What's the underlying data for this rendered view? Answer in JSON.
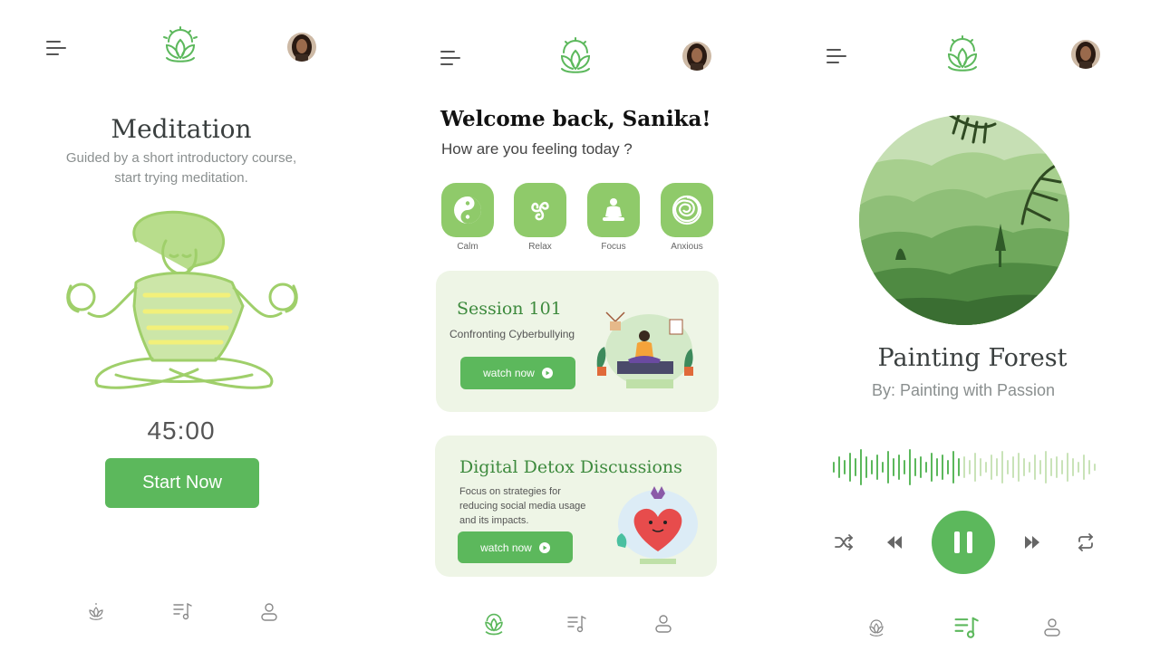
{
  "screen1": {
    "title": "Meditation",
    "subtitle_line1": "Guided by a short introductory course,",
    "subtitle_line2": "start trying meditation.",
    "timer": "45:00",
    "start_label": "Start Now"
  },
  "screen2": {
    "welcome": "Welcome back, Sanika!",
    "question": "How are you feeling today ?",
    "moods": [
      "Calm",
      "Relax",
      "Focus",
      "Anxious"
    ],
    "session_card": {
      "title": "Session 101",
      "subtitle": "Confronting Cyberbullying",
      "button": "watch now"
    },
    "detox_card": {
      "title": "Digital Detox Discussions",
      "desc_line1": "Focus on strategies for",
      "desc_line2": "reducing social media usage",
      "desc_line3": "and its impacts.",
      "button": "watch now"
    }
  },
  "screen3": {
    "track_title": "Painting Forest",
    "artist": "By: Painting with Passion"
  },
  "colors": {
    "accent": "#5cb85c",
    "light_green": "#8fca6a",
    "card_bg": "#eef5e6",
    "figure_green": "#9fcf6a",
    "text_dark": "#3a3f3f",
    "text_muted": "#8a8f8f"
  },
  "icons": [
    "menu-icon",
    "lotus-logo-icon",
    "avatar",
    "yin-yang-icon",
    "triskelion-icon",
    "buddha-icon",
    "spiral-icon",
    "play-circle-icon",
    "shuffle-icon",
    "rewind-icon",
    "pause-icon",
    "fast-forward-icon",
    "repeat-icon",
    "music-list-icon",
    "profile-icon"
  ]
}
